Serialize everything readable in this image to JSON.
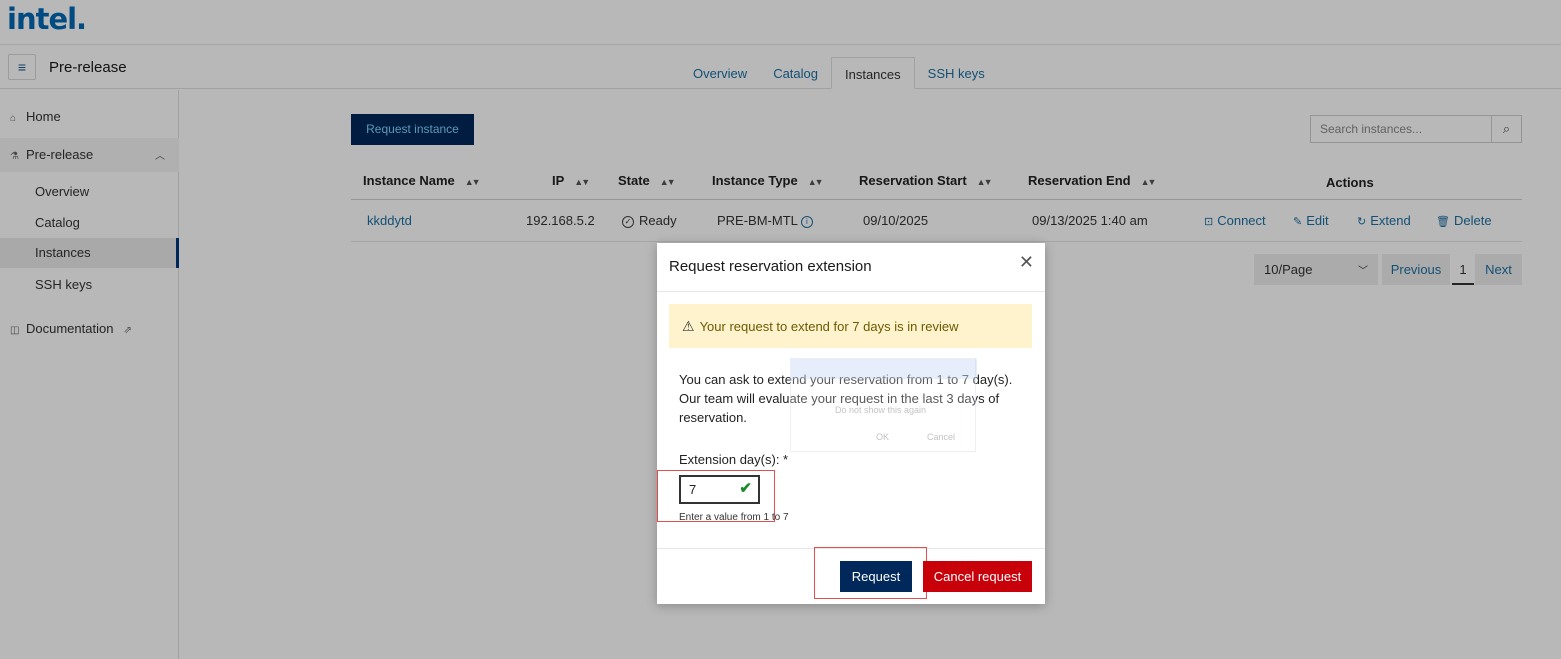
{
  "brand": {
    "logo": "intel."
  },
  "header": {
    "menu_icon": "≡",
    "section_title": "Pre-release",
    "tabs": [
      {
        "label": "Overview"
      },
      {
        "label": "Catalog"
      },
      {
        "label": "Instances",
        "active": true
      },
      {
        "label": "SSH keys"
      }
    ]
  },
  "sidebar": {
    "home": "Home",
    "prerelease": "Pre-release",
    "overview": "Overview",
    "catalog": "Catalog",
    "instances": "Instances",
    "ssh_keys": "SSH keys",
    "documentation": "Documentation"
  },
  "main": {
    "request_button": "Request instance",
    "search_placeholder": "Search instances...",
    "columns": {
      "name": "Instance Name",
      "ip": "IP",
      "state": "State",
      "type": "Instance Type",
      "start": "Reservation Start",
      "end": "Reservation End",
      "actions": "Actions"
    },
    "rows": [
      {
        "name": "kkddytd",
        "ip": "192.168.5.2",
        "state": "Ready",
        "type": "PRE-BM-MTL",
        "start": "09/10/2025",
        "end": "09/13/2025 1:40 am"
      }
    ],
    "actions": {
      "connect": "Connect",
      "edit": "Edit",
      "extend": "Extend",
      "delete": "Delete"
    },
    "pagination": {
      "per_page": "10/Page",
      "previous": "Previous",
      "page": "1",
      "next": "Next"
    }
  },
  "modal": {
    "title": "Request reservation extension",
    "warning": "Your request to extend for 7 days is in review",
    "description": "You can ask to extend your reservation from 1 to 7 day(s). Our team will evaluate your request in the last 3 days of reservation.",
    "field_label": "Extension day(s): *",
    "field_value": "7",
    "hint": "Enter a value from 1 to 7",
    "request_button": "Request",
    "cancel_button": "Cancel request"
  },
  "ghost_dialog": {
    "checkbox_label": "Do not show this again",
    "ok": "OK",
    "cancel": "Cancel"
  },
  "colors": {
    "brand_blue": "#0068b5",
    "primary_navy": "#00285a",
    "danger_red": "#c8000a",
    "link_blue": "#1c6fa3",
    "warning_bg": "#fef3cd"
  }
}
